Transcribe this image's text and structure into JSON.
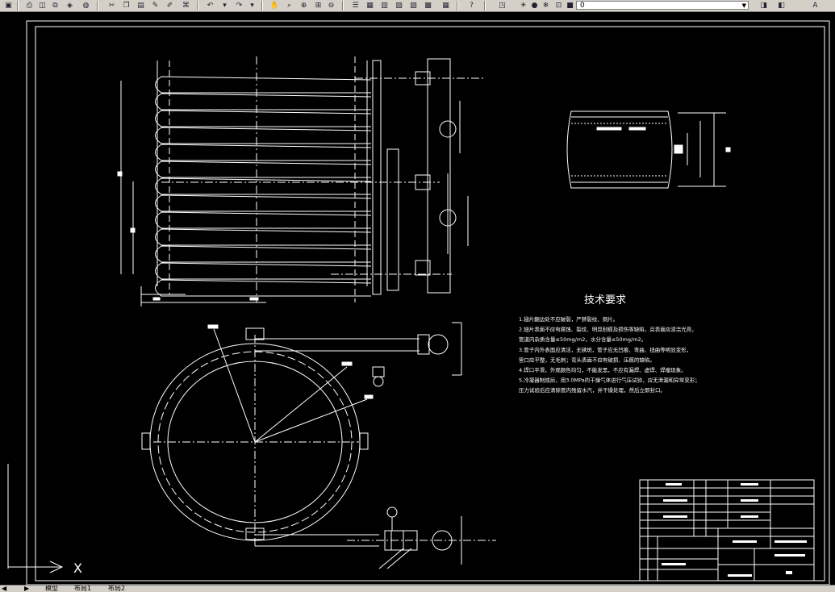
{
  "toolbar": {
    "layer_value": "0",
    "icons": [
      "save-icon",
      "print-icon",
      "plot-preview-icon",
      "publish-icon",
      "3d-icon",
      "cut-icon",
      "copy-icon",
      "paste-icon",
      "match-properties-icon",
      "block-editor-icon",
      "undo-icon",
      "redo-icon",
      "pan-icon",
      "zoom-realtime-icon",
      "zoom-window-icon",
      "zoom-previous-icon",
      "properties-icon",
      "design-center-icon",
      "tool-palettes-icon",
      "sheet-set-icon",
      "markup-icon",
      "calculator-icon",
      "help-icon",
      "layer-manager-icon",
      "lightbulb-icon",
      "sun-icon",
      "freeze-icon",
      "lock-icon",
      "color-square-icon"
    ]
  },
  "drawing": {
    "tech_title": "技术要求",
    "notes": [
      "1.翅片翻边处不应破裂，严禁裂纹、倒片。",
      "2.翅片表面不应有腐蚀、裂纹、明显刮痕及损伤等缺陷，且表面应清洁光亮，",
      "管道内杂质含量≤50mg/m2，水分含量≤50mg/m2。",
      "3.管子内外表面应清洁，无锈斑，管子应无凹痕、弯曲、扭曲等明显变形，",
      "管口应平整，无毛刺；弯头表面不应有破损、压痕的缺陷。",
      "4.焊口平滑，外观颜色均匀，不能发黑，不应有漏焊、虚焊、焊瘤现象。",
      "5.冷凝器制成后，用3.0MPa的干燥气体进行气压试验，应无泄漏和异常变形；",
      "压力试验后应清除管内残留水汽，并干燥处理，然后立即封口。"
    ],
    "ucs_label": "X"
  },
  "tabs": {
    "model": "模型",
    "layout1": "布局1",
    "layout2": "布局2"
  }
}
